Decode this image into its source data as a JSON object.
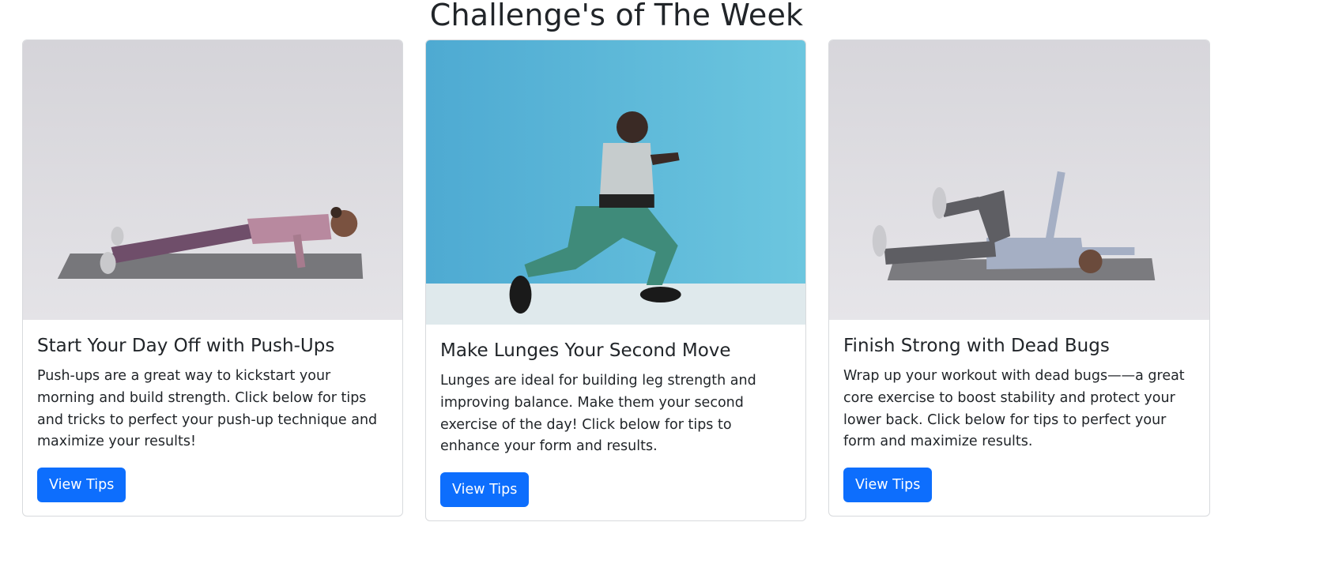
{
  "page": {
    "title": "Challenge's of The Week"
  },
  "cards": [
    {
      "title": "Start Your Day Off with Push-Ups",
      "text": "Push-ups are a great way to kickstart your morning and build strength. Click below for tips and tricks to perfect your push-up technique and maximize your results!",
      "button_label": "View Tips",
      "image_desc": "push-up-photo"
    },
    {
      "title": "Make Lunges Your Second Move",
      "text": "Lunges are ideal for building leg strength and improving balance. Make them your second exercise of the day! Click below for tips to enhance your form and results.",
      "button_label": "View Tips",
      "image_desc": "lunge-photo"
    },
    {
      "title": "Finish Strong with Dead Bugs",
      "text": "Wrap up your workout with dead bugs——a great core exercise to boost stability and protect your lower back. Click below for tips to perfect your form and maximize results.",
      "button_label": "View Tips",
      "image_desc": "dead-bug-photo"
    }
  ],
  "colors": {
    "primary_button": "#0d6efd",
    "lunge_wall": "#55b3d9",
    "studio_gray": "#dcdbdf"
  }
}
